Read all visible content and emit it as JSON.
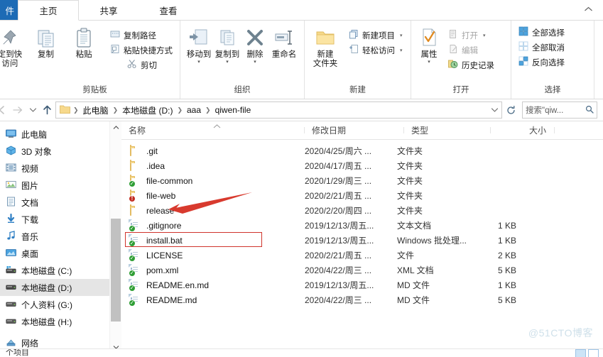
{
  "window": {
    "tabs": [
      {
        "id": "file",
        "label": "件",
        "full": "文件"
      },
      {
        "id": "home",
        "label": "主页"
      },
      {
        "id": "share",
        "label": "共享"
      },
      {
        "id": "view",
        "label": "查看"
      }
    ],
    "collapse_icon": "chevron-up"
  },
  "ribbon": {
    "groups": [
      {
        "name": "clipboard",
        "label": "剪贴板",
        "big": [
          {
            "name": "pin-to-quick-access",
            "label": "定到快\n访问",
            "icon": "pin-icon"
          },
          {
            "name": "copy",
            "label": "复制",
            "icon": "copy-icon"
          },
          {
            "name": "paste",
            "label": "粘贴",
            "icon": "paste-icon"
          }
        ],
        "small": [
          {
            "name": "copy-path",
            "label": "复制路径",
            "icon": "copy-path-icon"
          },
          {
            "name": "paste-shortcut",
            "label": "粘贴快捷方式",
            "icon": "paste-shortcut-icon"
          },
          {
            "name": "cut",
            "label": "剪切",
            "icon": "scissors-icon"
          }
        ]
      },
      {
        "name": "organize",
        "label": "组织",
        "big": [
          {
            "name": "move-to",
            "label": "移动到",
            "icon": "move-to-icon",
            "caret": true
          },
          {
            "name": "copy-to",
            "label": "复制到",
            "icon": "copy-to-icon",
            "caret": true
          },
          {
            "name": "delete",
            "label": "删除",
            "icon": "delete-x-icon",
            "caret": true
          },
          {
            "name": "rename",
            "label": "重命名",
            "icon": "rename-icon"
          }
        ]
      },
      {
        "name": "new",
        "label": "新建",
        "big": [
          {
            "name": "new-folder",
            "label": "新建\n文件夹",
            "icon": "new-folder-icon"
          }
        ],
        "small": [
          {
            "name": "new-item",
            "label": "新建项目",
            "icon": "new-item-icon",
            "caret": true
          },
          {
            "name": "easy-access",
            "label": "轻松访问",
            "icon": "easy-access-icon",
            "caret": true
          }
        ]
      },
      {
        "name": "open",
        "label": "打开",
        "big": [
          {
            "name": "properties",
            "label": "属性",
            "icon": "properties-icon",
            "caret": true
          }
        ],
        "small": [
          {
            "name": "open",
            "label": "打开",
            "icon": "open-icon",
            "caret": true,
            "disabled": true
          },
          {
            "name": "edit",
            "label": "编辑",
            "icon": "edit-icon",
            "disabled": true
          },
          {
            "name": "history",
            "label": "历史记录",
            "icon": "history-icon"
          }
        ]
      },
      {
        "name": "select",
        "label": "选择",
        "small": [
          {
            "name": "select-all",
            "label": "全部选择",
            "icon": "select-all-icon"
          },
          {
            "name": "select-none",
            "label": "全部取消",
            "icon": "select-none-icon"
          },
          {
            "name": "invert-selection",
            "label": "反向选择",
            "icon": "invert-selection-icon"
          }
        ]
      }
    ]
  },
  "addressbar": {
    "back_icon": "arrow-left-icon",
    "forward_icon": "arrow-right-icon",
    "recent_icon": "chevron-down-icon",
    "up_icon": "arrow-up-icon",
    "folder_icon": "folder-icon",
    "breadcrumbs": [
      "此电脑",
      "本地磁盘 (D:)",
      "aaa",
      "qiwen-file"
    ],
    "dropdown_icon": "chevron-down-icon",
    "refresh_icon": "refresh-icon",
    "search_placeholder": "搜索\"qiw...",
    "search_icon": "search-icon"
  },
  "sidebar": {
    "items": [
      {
        "name": "this-pc",
        "label": "此电脑",
        "icon": "monitor-icon",
        "selected": false
      },
      {
        "name": "3d-objects",
        "label": "3D 对象",
        "icon": "cube-icon",
        "selected": false
      },
      {
        "name": "videos",
        "label": "视频",
        "icon": "video-icon",
        "selected": false
      },
      {
        "name": "pictures",
        "label": "图片",
        "icon": "picture-icon",
        "selected": false
      },
      {
        "name": "documents",
        "label": "文档",
        "icon": "document-icon",
        "selected": false
      },
      {
        "name": "downloads",
        "label": "下载",
        "icon": "download-icon",
        "selected": false
      },
      {
        "name": "music",
        "label": "音乐",
        "icon": "music-icon",
        "selected": false
      },
      {
        "name": "desktop",
        "label": "桌面",
        "icon": "desktop-icon",
        "selected": false
      },
      {
        "name": "drive-c",
        "label": "本地磁盘 (C:)",
        "icon": "drive-sys-icon",
        "selected": false
      },
      {
        "name": "drive-d",
        "label": "本地磁盘 (D:)",
        "icon": "drive-icon",
        "selected": true
      },
      {
        "name": "drive-g",
        "label": "个人资料 (G:)",
        "icon": "drive-icon",
        "selected": false
      },
      {
        "name": "drive-h",
        "label": "本地磁盘 (H:)",
        "icon": "drive-icon",
        "selected": false
      },
      {
        "name": "network",
        "label": "网络",
        "icon": "network-icon",
        "selected": false
      }
    ],
    "scroll_up_icon": "chevron-up-icon",
    "scroll_down_icon": "chevron-down-icon"
  },
  "filelist": {
    "columns": [
      {
        "name": "name",
        "label": "名称",
        "sorted": true
      },
      {
        "name": "date",
        "label": "修改日期"
      },
      {
        "name": "type",
        "label": "类型"
      },
      {
        "name": "size",
        "label": "大小"
      }
    ],
    "rows": [
      {
        "name": ".git",
        "date": "2020/4/25/周六 ...",
        "type": "文件夹",
        "size": "",
        "icon": "folder",
        "overlay": ""
      },
      {
        "name": ".idea",
        "date": "2020/4/17/周五 ...",
        "type": "文件夹",
        "size": "",
        "icon": "folder",
        "overlay": ""
      },
      {
        "name": "file-common",
        "date": "2020/1/29/周三 ...",
        "type": "文件夹",
        "size": "",
        "icon": "folder",
        "overlay": "ok"
      },
      {
        "name": "file-web",
        "date": "2020/2/21/周五 ...",
        "type": "文件夹",
        "size": "",
        "icon": "folder",
        "overlay": "err"
      },
      {
        "name": "release",
        "date": "2020/2/20/周四 ...",
        "type": "文件夹",
        "size": "",
        "icon": "folder",
        "overlay": ""
      },
      {
        "name": ".gitignore",
        "date": "2019/12/13/周五...",
        "type": "文本文档",
        "size": "1 KB",
        "icon": "doc",
        "overlay": "ok"
      },
      {
        "name": "install.bat",
        "date": "2019/12/13/周五...",
        "type": "Windows 批处理...",
        "size": "1 KB",
        "icon": "doc",
        "overlay": "ok",
        "highlighted": true
      },
      {
        "name": "LICENSE",
        "date": "2020/2/21/周五 ...",
        "type": "文件",
        "size": "2 KB",
        "icon": "doc",
        "overlay": "ok"
      },
      {
        "name": "pom.xml",
        "date": "2020/4/22/周三 ...",
        "type": "XML 文档",
        "size": "5 KB",
        "icon": "doc",
        "overlay": "ok"
      },
      {
        "name": "README.en.md",
        "date": "2019/12/13/周五...",
        "type": "MD 文件",
        "size": "1 KB",
        "icon": "doc",
        "overlay": "ok"
      },
      {
        "name": "README.md",
        "date": "2020/4/22/周三 ...",
        "type": "MD 文件",
        "size": "5 KB",
        "icon": "doc",
        "overlay": "ok"
      }
    ]
  },
  "annotations": {
    "arrow_color": "#d0342c",
    "rect_color": "#d0342c",
    "arrow_target": "release",
    "rect_target": "install.bat"
  },
  "watermark": {
    "text": "@51CTO博客"
  },
  "statusbar": {
    "text": "个项目"
  }
}
